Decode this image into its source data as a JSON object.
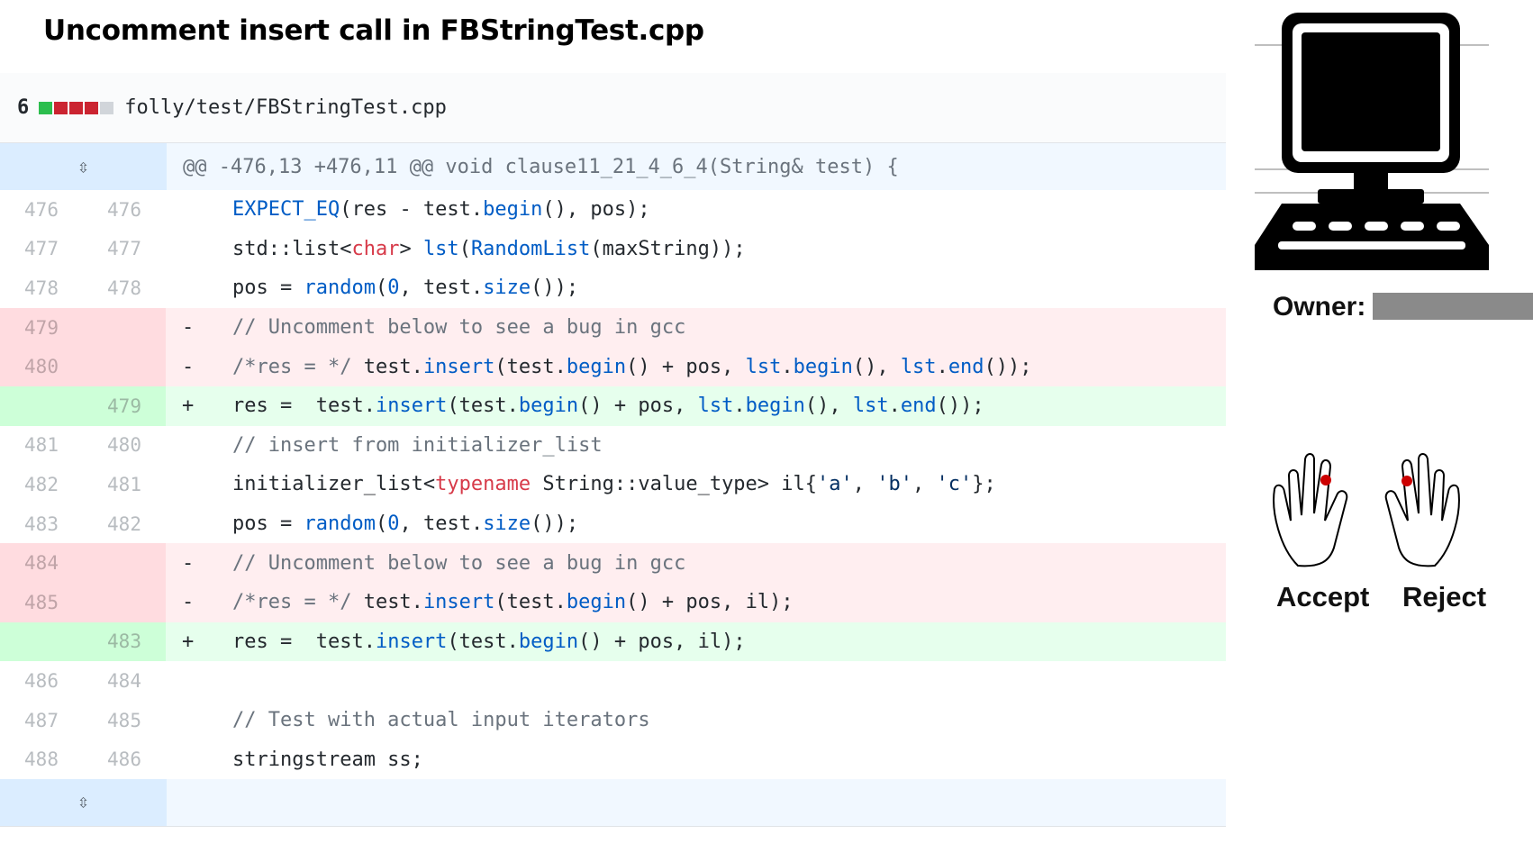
{
  "title": "Uncomment insert call in FBStringTest.cpp",
  "file_header": {
    "change_count": "6",
    "diffstat": [
      "green",
      "red",
      "red",
      "red",
      "gray"
    ],
    "path": "folly/test/FBStringTest.cpp"
  },
  "hunk_header": "@@ -476,13 +476,11 @@ void clause11_21_4_6_4(String& test) {",
  "expand_icon": "unfold-icon",
  "lines": [
    {
      "type": "ctx",
      "old": "476",
      "new": "476",
      "sign": "",
      "code": "EXPECT_EQ(res - test.begin(), pos);"
    },
    {
      "type": "ctx",
      "old": "477",
      "new": "477",
      "sign": "",
      "code": "std::list<char> lst(RandomList(maxString));"
    },
    {
      "type": "ctx",
      "old": "478",
      "new": "478",
      "sign": "",
      "code": "pos = random(0, test.size());"
    },
    {
      "type": "del",
      "old": "479",
      "new": "",
      "sign": "-",
      "code": "// Uncomment below to see a bug in gcc"
    },
    {
      "type": "del",
      "old": "480",
      "new": "",
      "sign": "-",
      "code": "/*res = */ test.insert(test.begin() + pos, lst.begin(), lst.end());"
    },
    {
      "type": "add",
      "old": "",
      "new": "479",
      "sign": "+",
      "code": "res =  test.insert(test.begin() + pos, lst.begin(), lst.end());"
    },
    {
      "type": "ctx",
      "old": "481",
      "new": "480",
      "sign": "",
      "code": "// insert from initializer_list"
    },
    {
      "type": "ctx",
      "old": "482",
      "new": "481",
      "sign": "",
      "code": "initializer_list<typename String::value_type> il{'a', 'b', 'c'};"
    },
    {
      "type": "ctx",
      "old": "483",
      "new": "482",
      "sign": "",
      "code": "pos = random(0, test.size());"
    },
    {
      "type": "del",
      "old": "484",
      "new": "",
      "sign": "-",
      "code": "// Uncomment below to see a bug in gcc"
    },
    {
      "type": "del",
      "old": "485",
      "new": "",
      "sign": "-",
      "code": "/*res = */ test.insert(test.begin() + pos, il);"
    },
    {
      "type": "add",
      "old": "",
      "new": "483",
      "sign": "+",
      "code": "res =  test.insert(test.begin() + pos, il);"
    },
    {
      "type": "ctx",
      "old": "486",
      "new": "484",
      "sign": "",
      "code": ""
    },
    {
      "type": "ctx",
      "old": "487",
      "new": "485",
      "sign": "",
      "code": "// Test with actual input iterators"
    },
    {
      "type": "ctx",
      "old": "488",
      "new": "486",
      "sign": "",
      "code": "stringstream ss;"
    }
  ],
  "owner_label": "Owner:",
  "accept_label": "Accept",
  "reject_label": "Reject",
  "icons": {
    "computer": "computer-icon",
    "accept_hand": "hand-accept-icon",
    "reject_hand": "hand-reject-icon"
  },
  "colors": {
    "del_bg": "#ffeef0",
    "add_bg": "#e6ffed",
    "hunk_bg": "#f1f8ff",
    "finger_dot": "#cc0000"
  }
}
